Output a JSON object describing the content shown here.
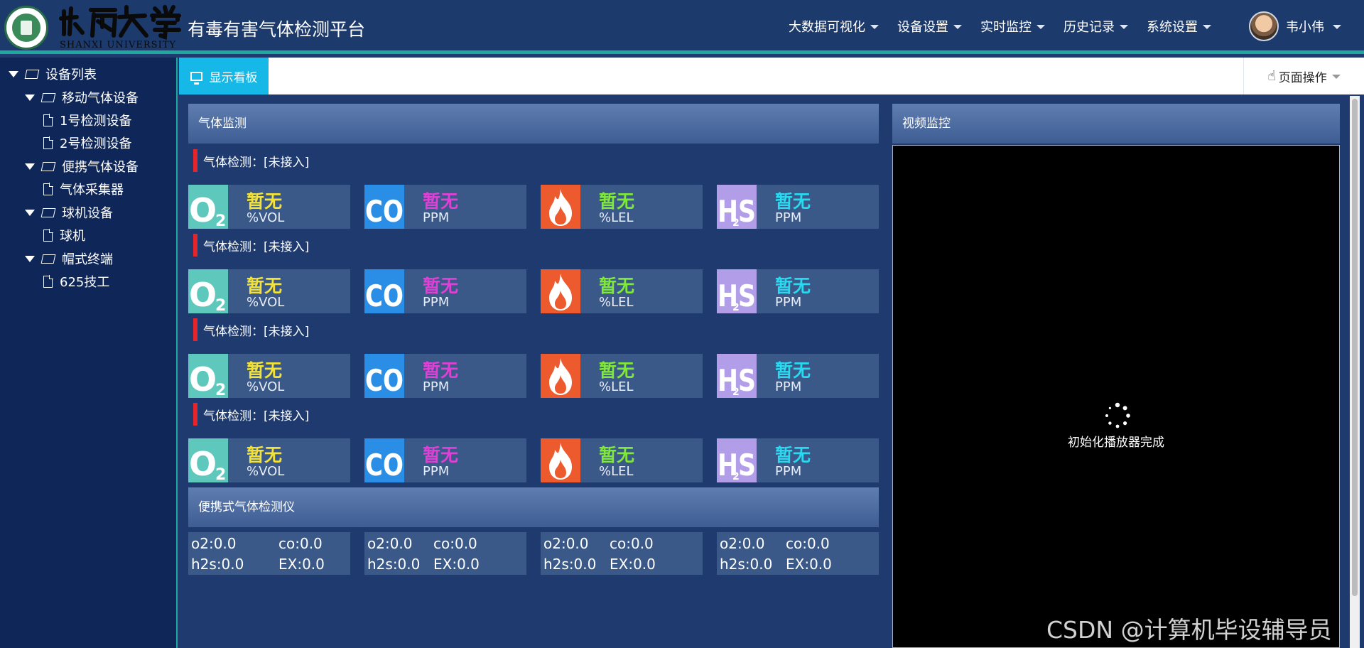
{
  "header": {
    "university_calligraphy": "山西大学",
    "university_en": "SHANXI UNIVERSITY",
    "app_title": "有毒有害气体检测平台",
    "nav": [
      "大数据可视化",
      "设备设置",
      "实时监控",
      "历史记录",
      "系统设置"
    ],
    "user_name": "韦小伟"
  },
  "sidebar": {
    "root": "设备列表",
    "groups": [
      {
        "label": "移动气体设备",
        "children": [
          "1号检测设备",
          "2号检测设备"
        ]
      },
      {
        "label": "便携气体设备",
        "children": [
          "气体采集器"
        ]
      },
      {
        "label": "球机设备",
        "children": [
          "球机"
        ]
      },
      {
        "label": "帽式终端",
        "children": [
          "625技工"
        ]
      }
    ]
  },
  "tabs": {
    "active": "显示看板",
    "page_ops": "页面操作"
  },
  "gas_panel": {
    "title": "气体监测",
    "sections": [
      {
        "label": "气体检测：[未接入]"
      },
      {
        "label": "气体检测：[未接入]"
      },
      {
        "label": "气体检测：[未接入]"
      },
      {
        "label": "气体检测：[未接入]"
      }
    ],
    "cards": [
      {
        "icon": "o2-icon",
        "value": "暂无",
        "unit": "%VOL",
        "color": "#f2e23a"
      },
      {
        "icon": "co-icon",
        "value": "暂无",
        "unit": "PPM",
        "color": "#e040d6"
      },
      {
        "icon": "flame-icon",
        "value": "暂无",
        "unit": "%LEL",
        "color": "#7fe83a"
      },
      {
        "icon": "h2s-icon",
        "value": "暂无",
        "unit": "PPM",
        "color": "#2ad8ef"
      }
    ]
  },
  "portable_panel": {
    "title": "便携式气体检测仪",
    "devices": [
      {
        "o2": "o2:0.0",
        "co": "co:0.0",
        "h2s": "h2s:0.0",
        "ex": "EX:0.0"
      },
      {
        "o2": "o2:0.0",
        "co": "co:0.0",
        "h2s": "h2s:0.0",
        "ex": "EX:0.0"
      },
      {
        "o2": "o2:0.0",
        "co": "co:0.0",
        "h2s": "h2s:0.0",
        "ex": "EX:0.0"
      },
      {
        "o2": "o2:0.0",
        "co": "co:0.0",
        "h2s": "h2s:0.0",
        "ex": "EX:0.0"
      }
    ]
  },
  "video_panel": {
    "title": "视频监控",
    "status": "初始化播放器完成"
  },
  "watermark": "CSDN @计算机毕设辅导员"
}
